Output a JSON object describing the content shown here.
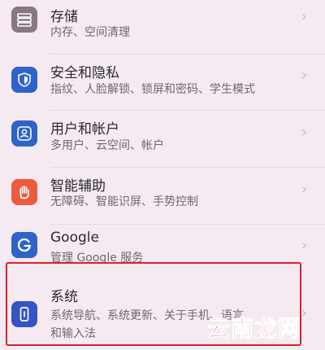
{
  "settings": {
    "items": [
      {
        "title": "存储",
        "subtitle": "内存、空间清理",
        "icon": "storage-icon",
        "icon_color": "#8A7786"
      },
      {
        "title": "安全和隐私",
        "subtitle": "指纹、人脸解锁、锁屏和密码、学生模式",
        "icon": "shield-icon",
        "icon_color": "#2F63C8"
      },
      {
        "title": "用户和帐户",
        "subtitle": "多用户、云空间、帐户",
        "icon": "user-account-icon",
        "icon_color": "#2F63C8"
      },
      {
        "title": "智能辅助",
        "subtitle": "无障碍、智能识屏、手势控制",
        "icon": "hand-icon",
        "icon_color": "#EE5A3C"
      },
      {
        "title": "Google",
        "subtitle": "管理 Google 服务",
        "icon": "google-icon",
        "icon_color": "#2F63C8"
      },
      {
        "title": "系统",
        "subtitle_line1": "系统导航、系统更新、关于手机、语言",
        "subtitle_line2": "和输入法",
        "icon": "phone-system-icon",
        "icon_color": "#3453C4"
      }
    ],
    "chevron": "›"
  },
  "watermark": {
    "text": "云南龙网"
  },
  "colors": {
    "background": "#F5EAF1",
    "highlight_border": "#E01F2A",
    "watermark": "#CF2222"
  }
}
